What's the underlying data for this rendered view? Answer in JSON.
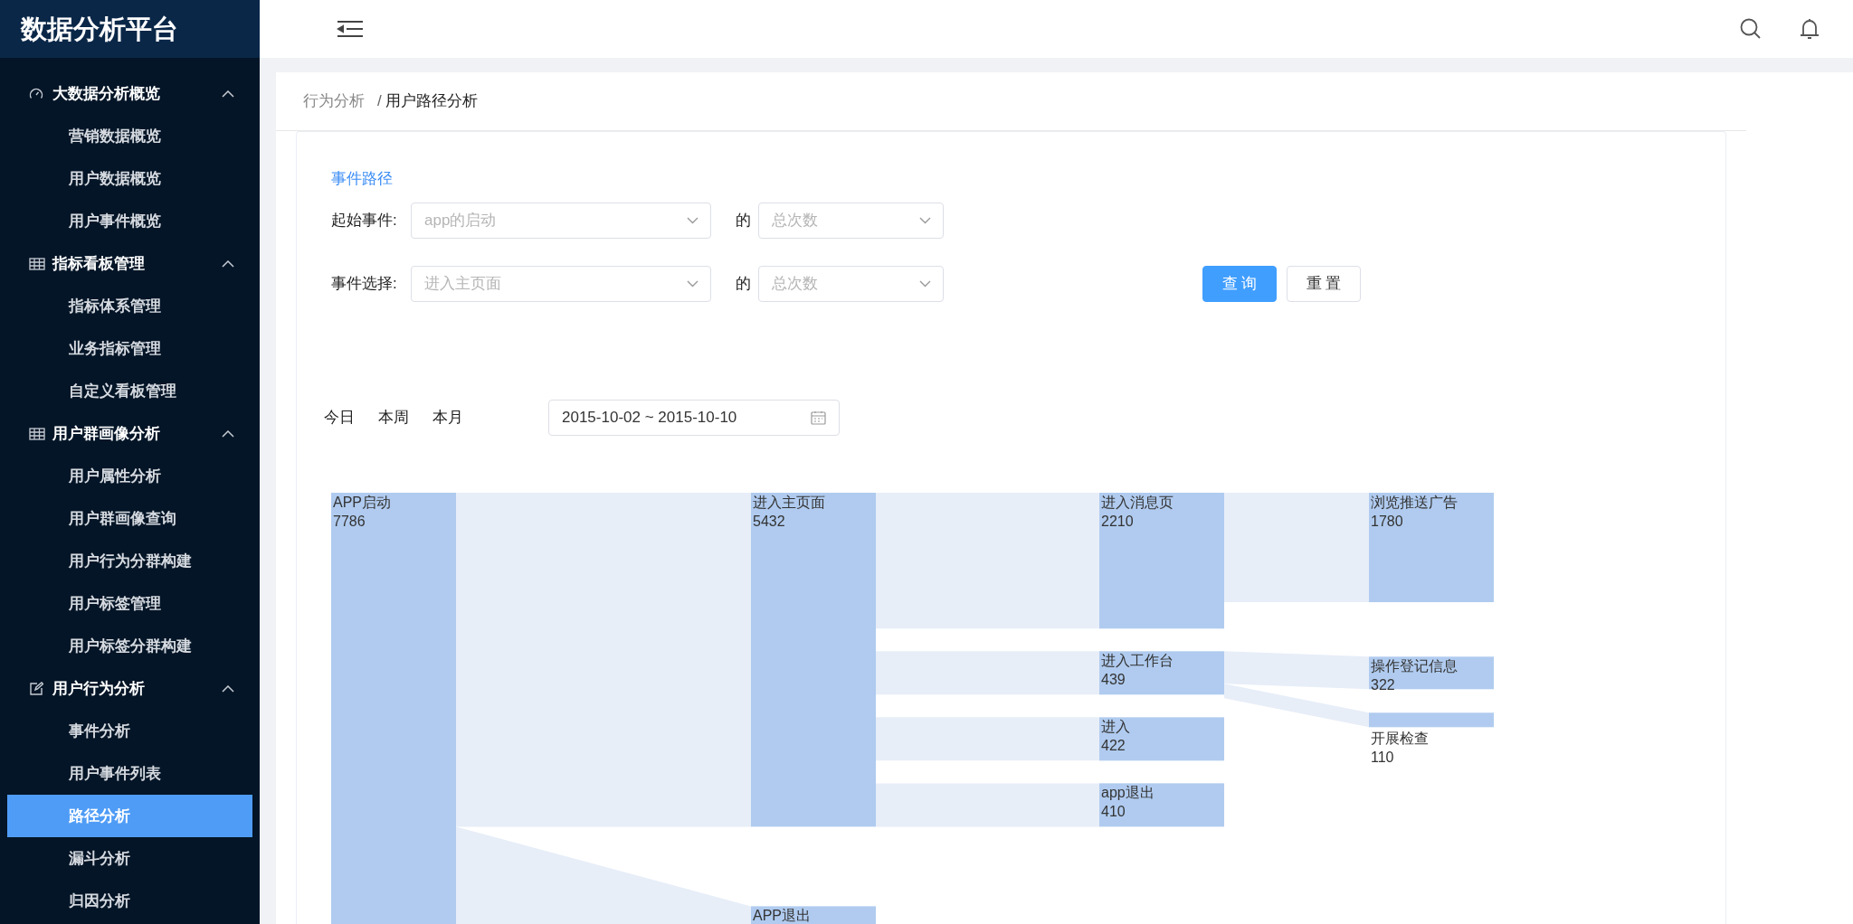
{
  "app_title": "数据分析平台",
  "sidebar": {
    "groups": [
      {
        "label": "大数据分析概览",
        "kind": "gauge",
        "expanded": true,
        "children": [
          {
            "label": "营销数据概览",
            "selected": false
          },
          {
            "label": "用户数据概览",
            "selected": false
          },
          {
            "label": "用户事件概览",
            "selected": false
          }
        ]
      },
      {
        "label": "指标看板管理",
        "kind": "table",
        "expanded": true,
        "children": [
          {
            "label": "指标体系管理",
            "selected": false
          },
          {
            "label": "业务指标管理",
            "selected": false
          },
          {
            "label": "自定义看板管理",
            "selected": false
          }
        ]
      },
      {
        "label": "用户群画像分析",
        "kind": "table",
        "expanded": true,
        "children": [
          {
            "label": "用户属性分析",
            "selected": false
          },
          {
            "label": "用户群画像查询",
            "selected": false
          },
          {
            "label": "用户行为分群构建",
            "selected": false
          },
          {
            "label": "用户标签管理",
            "selected": false
          },
          {
            "label": "用户标签分群构建",
            "selected": false
          }
        ]
      },
      {
        "label": "用户行为分析",
        "kind": "edit",
        "expanded": true,
        "children": [
          {
            "label": "事件分析",
            "selected": false
          },
          {
            "label": "用户事件列表",
            "selected": false
          },
          {
            "label": "路径分析",
            "selected": true
          },
          {
            "label": "漏斗分析",
            "selected": false
          },
          {
            "label": "归因分析",
            "selected": false
          }
        ]
      }
    ]
  },
  "breadcrumb": {
    "items": [
      "行为分析",
      "用户路径分析"
    ],
    "separator": "/"
  },
  "form": {
    "title": "事件路径",
    "rows": [
      {
        "label": "起始事件:",
        "event_placeholder": "app的启动",
        "connector": "的",
        "metric_placeholder": "总次数"
      },
      {
        "label": "事件选择:",
        "event_placeholder": "进入主页面",
        "connector": "的",
        "metric_placeholder": "总次数"
      }
    ],
    "buttons": [
      {
        "label": "查 询",
        "kind": "primary"
      },
      {
        "label": "重 置",
        "kind": "default"
      }
    ]
  },
  "date_filter": {
    "quick_ranges": [
      "今日",
      "本周",
      "本月"
    ],
    "range": "2015-10-02 ~ 2015-10-10"
  },
  "sankey": {
    "root": {
      "label": "APP启动",
      "value": "7786",
      "children": [
        {
          "label": "进入主页面",
          "value": "5432",
          "children": [
            {
              "label": "进入消息页",
              "value": "2210",
              "children": [
                {
                  "label": "浏览推送广告",
                  "value": "1780"
                }
              ]
            },
            {
              "label": "进入工作台",
              "value": "439",
              "children": [
                {
                  "label": "操作登记信息",
                  "value": "322"
                },
                {
                  "label": "开展检查",
                  "value": "110"
                }
              ]
            },
            {
              "label": "进入",
              "value": "422"
            },
            {
              "label": "app退出",
              "value": "410"
            }
          ]
        },
        {
          "label": "APP退出"
        }
      ]
    }
  }
}
